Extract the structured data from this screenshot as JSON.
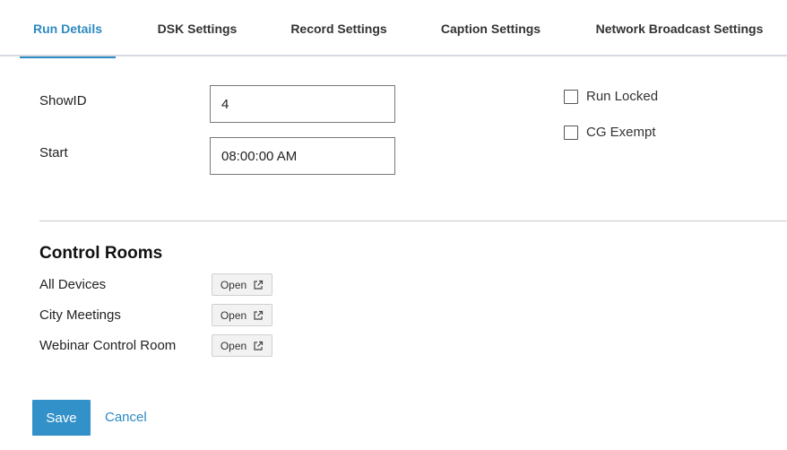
{
  "tabs": [
    {
      "label": "Run Details",
      "active": true
    },
    {
      "label": "DSK Settings",
      "active": false
    },
    {
      "label": "Record Settings",
      "active": false
    },
    {
      "label": "Caption Settings",
      "active": false
    },
    {
      "label": "Network Broadcast Settings",
      "active": false
    }
  ],
  "form": {
    "showid_label": "ShowID",
    "showid_value": "4",
    "start_label": "Start",
    "start_value": "08:00:00 AM"
  },
  "checks": {
    "run_locked_label": "Run Locked",
    "run_locked_checked": false,
    "cg_exempt_label": "CG Exempt",
    "cg_exempt_checked": false
  },
  "control_rooms": {
    "title": "Control Rooms",
    "open_label": "Open",
    "open_icon": "external-link-icon",
    "items": [
      {
        "name": "All Devices"
      },
      {
        "name": "City Meetings"
      },
      {
        "name": "Webinar Control Room"
      }
    ]
  },
  "actions": {
    "save_label": "Save",
    "cancel_label": "Cancel"
  },
  "colors": {
    "accent": "#2d8ac2",
    "save_bg": "#3391c9"
  }
}
